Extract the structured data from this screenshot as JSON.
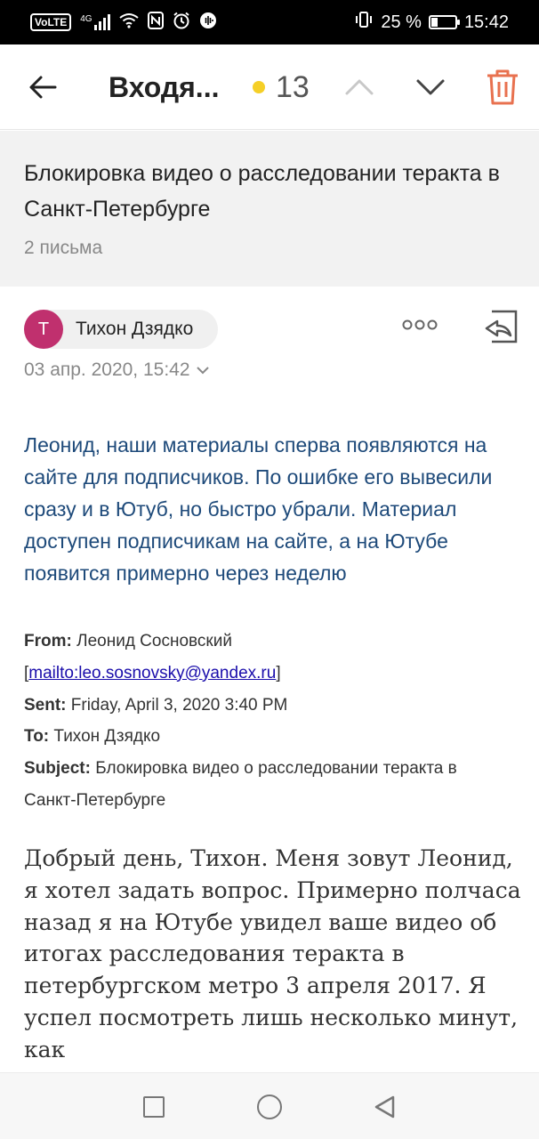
{
  "status_bar": {
    "volte": "VoLTE",
    "network": "4G",
    "battery_percent": "25 %",
    "battery_level": 0.25,
    "time": "15:42"
  },
  "app_bar": {
    "folder_title": "Входя...",
    "unread_count": "13",
    "unread_dot_color": "#f5cf27",
    "icons": [
      "back-arrow-icon",
      "chevron-up-icon",
      "chevron-down-icon",
      "trash-icon"
    ],
    "trash_color": "#e8714f"
  },
  "thread": {
    "subject": "Блокировка видео о расследовании теракта в Санкт-Петербурге",
    "count_label": "2 письма"
  },
  "message": {
    "avatar_letter": "Т",
    "avatar_color": "#c0306e",
    "sender": "Тихон Дзядко",
    "date": "03 апр. 2020, 15:42",
    "reply_text": "Леонид, наши материалы сперва появляются на сайте для подписчиков. По ошибке его вывесили сразу и в Ютуб, но быстро убрали. Материал доступен подписчикам на сайте, а на Ютубе появится примерно через неделю",
    "quoted": {
      "from_label": "From:",
      "from_value": "Леонид Сосновский",
      "mailto_open": "[",
      "mailto": "mailto:leo.sosnovsky@yandex.ru",
      "mailto_close": "]",
      "sent_label": "Sent:",
      "sent_value": "Friday, April 3, 2020 3:40 PM",
      "to_label": "To:",
      "to_value": "Тихон Дзядко",
      "subject_label": "Subject:",
      "subject_value": "Блокировка видео о расследовании теракта в Санкт-Петербурге"
    },
    "body": "Добрый день, Тихон. Меня зовут Леонид, я хотел задать вопрос. Примерно полчаса назад я на Ютубе увидел ваше видео об итогах расследования теракта в петербургском метро 3 апреля 2017. Я успел посмотреть лишь несколько минут, как"
  },
  "nav_bar": {
    "icons": [
      "recents-square-icon",
      "home-circle-icon",
      "back-triangle-icon"
    ]
  }
}
